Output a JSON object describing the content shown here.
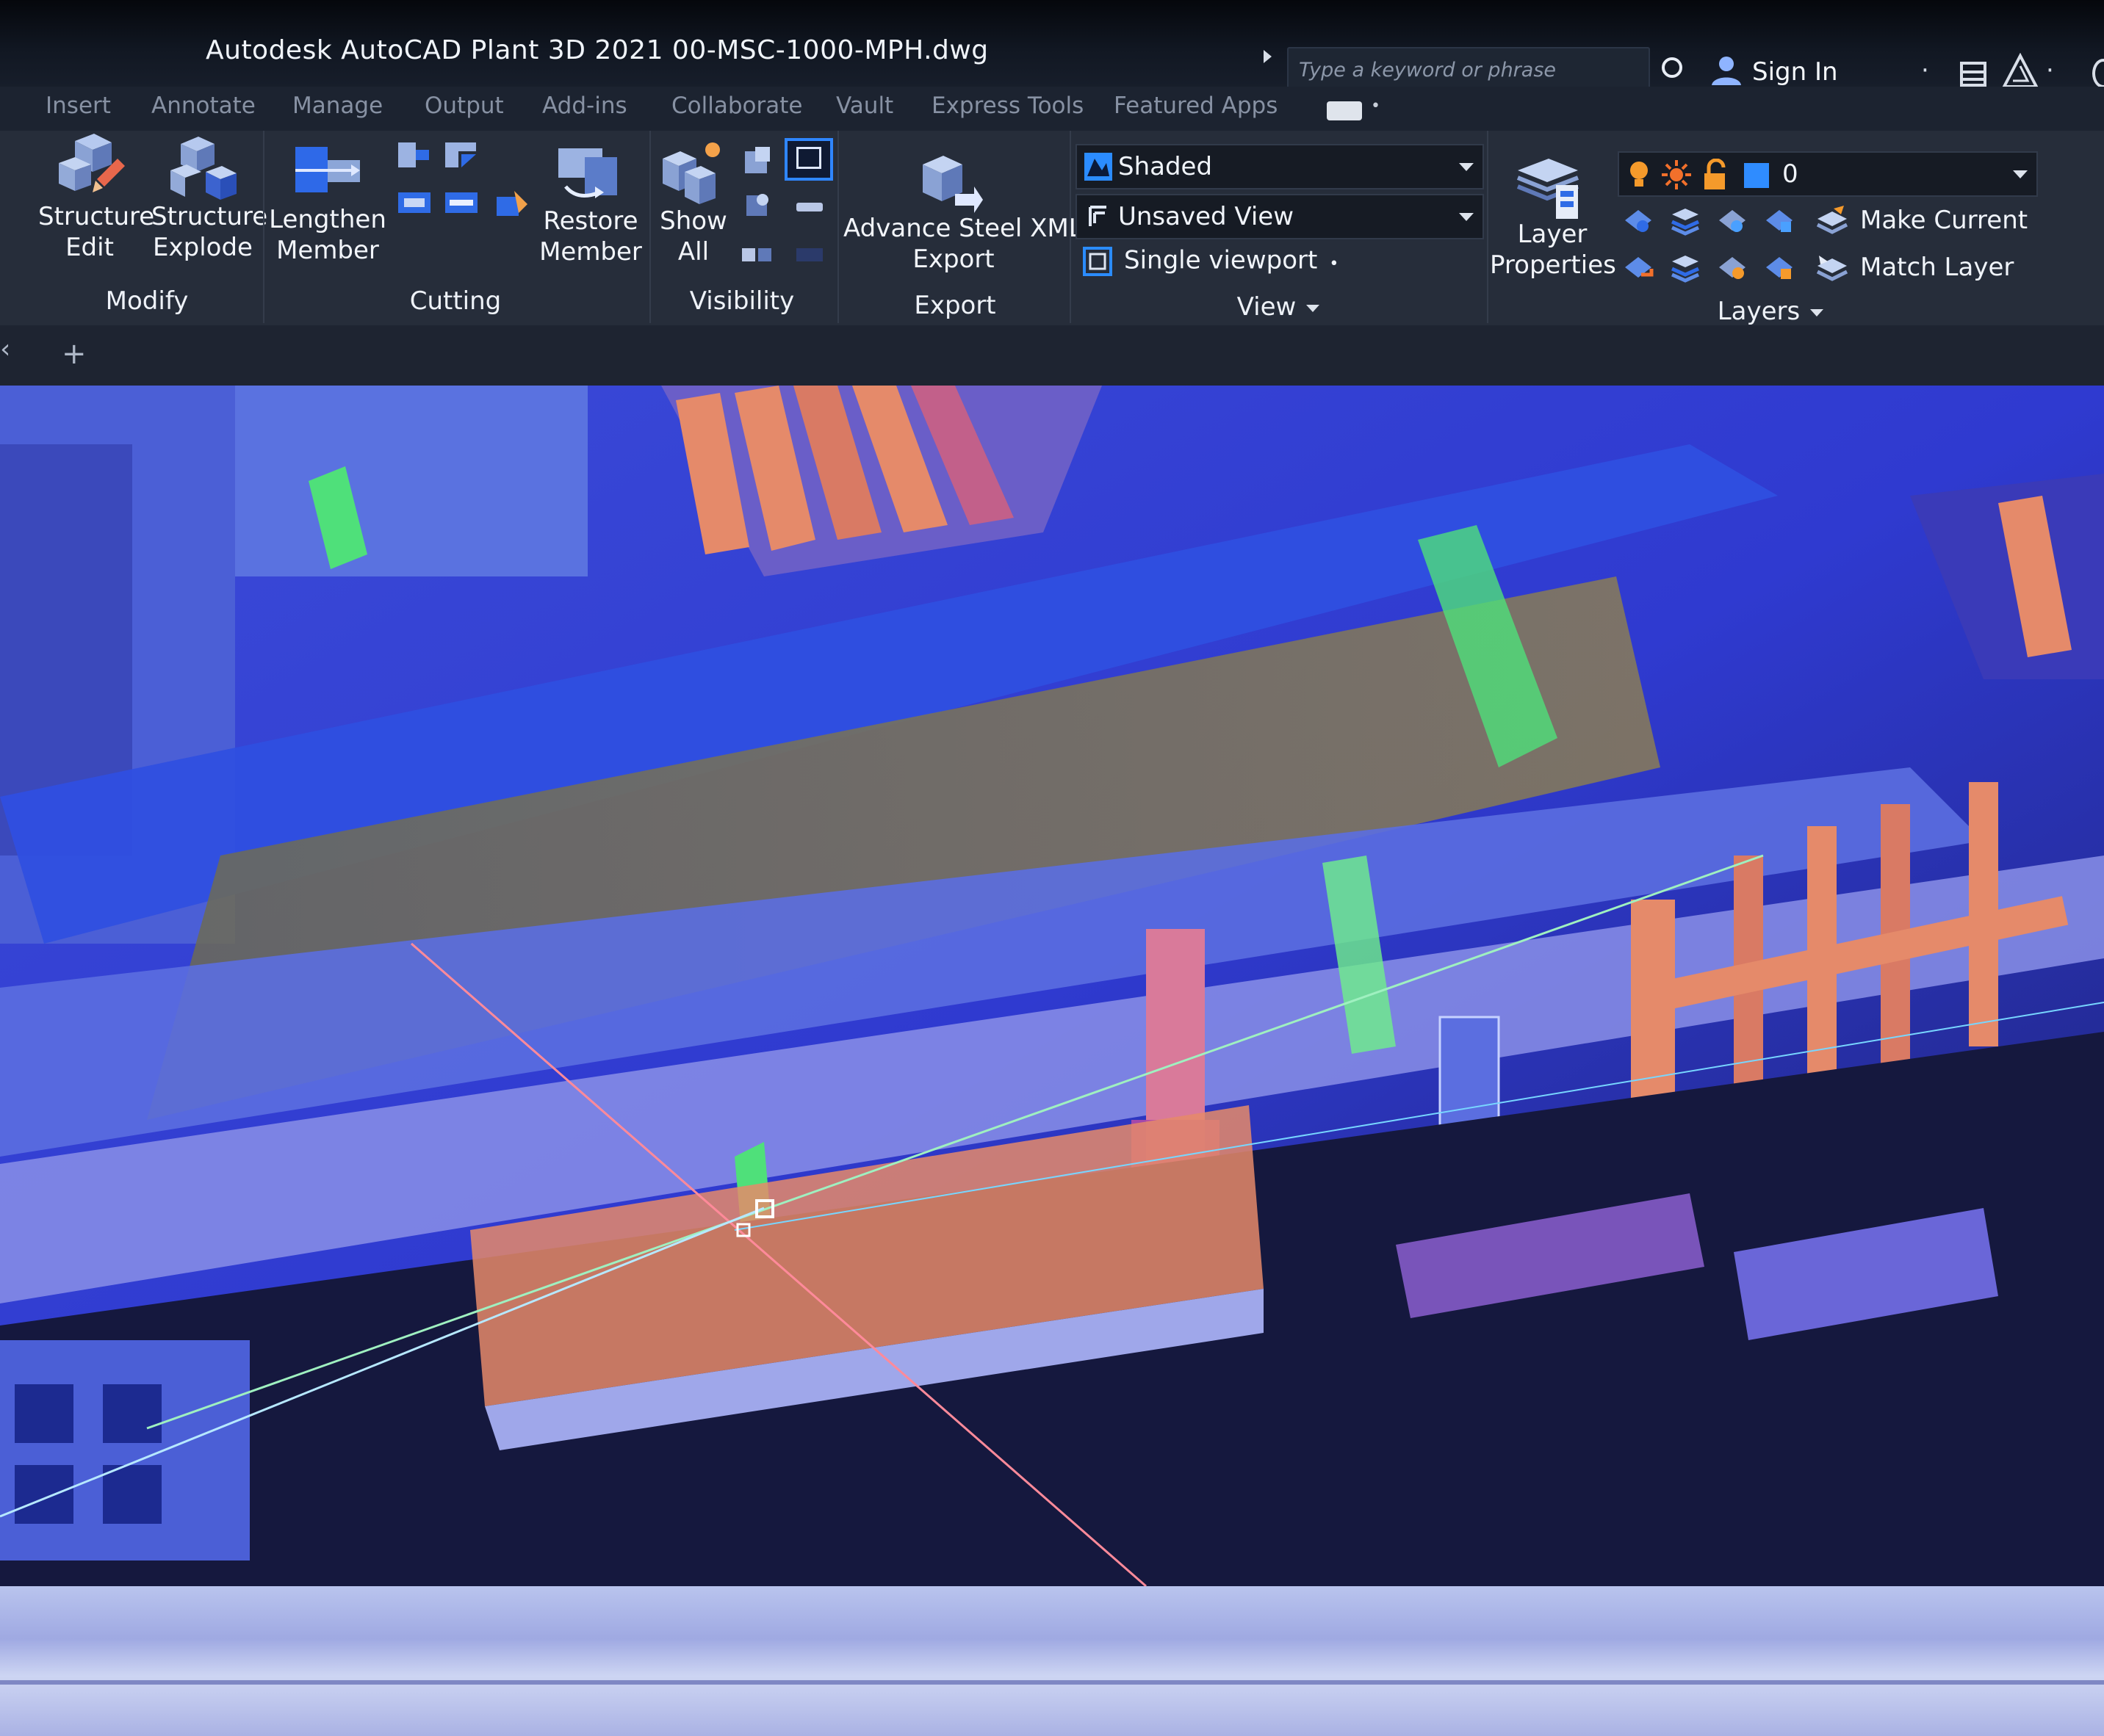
{
  "title_bar": {
    "app_title": "Autodesk AutoCAD Plant 3D 2021    00-MSC-1000-MPH.dwg",
    "search_placeholder": "Type a keyword or phrase",
    "sign_in": "Sign In"
  },
  "tabs": [
    "Insert",
    "Annotate",
    "Manage",
    "Output",
    "Add-ins",
    "Collaborate",
    "Vault",
    "Express Tools",
    "Featured Apps"
  ],
  "ribbon": {
    "modify": {
      "title": "Modify",
      "structure_edit": [
        "Structure",
        "Edit"
      ],
      "structure_explode": [
        "Structure",
        "Explode"
      ]
    },
    "cutting": {
      "title": "Cutting",
      "lengthen_member": [
        "Lengthen",
        "Member"
      ],
      "restore_member": [
        "Restore",
        "Member"
      ]
    },
    "visibility": {
      "title": "Visibility",
      "show_all": [
        "Show",
        "All"
      ]
    },
    "export": {
      "title": "Export",
      "advance_steel": [
        "Advance Steel XML",
        "Export"
      ]
    },
    "view": {
      "title": "View",
      "visual_style": "Shaded",
      "named_view": "Unsaved View",
      "viewport_config": "Single viewport"
    },
    "layers": {
      "title": "Layers",
      "layer_properties": [
        "Layer",
        "Properties"
      ],
      "current_layer": "0",
      "make_current": "Make Current",
      "match_layer": "Match Layer"
    }
  },
  "file_tabs": {
    "close_glyph": "‹",
    "new_tab_glyph": "+"
  },
  "icons": [
    "search-arrow-icon",
    "help-circle-icon",
    "user-icon",
    "cart-icon",
    "autodesk-triangle-icon",
    "structure-edit-icon",
    "structure-explode-icon",
    "lengthen-member-icon",
    "restore-member-icon",
    "show-all-icon",
    "advance-steel-export-icon",
    "layer-properties-icon",
    "lightbulb-icon",
    "sun-icon",
    "lock-icon"
  ],
  "colors": {
    "ribbon_bg": "#262d3a",
    "title_bg": "#111722",
    "accent_blue": "#2f80ff",
    "pointcloud_blue": "#3b3fd9",
    "pointcloud_orange": "#e58a6a",
    "pointcloud_green": "#4fe07a",
    "pointcloud_magenta": "#c13bd4"
  }
}
